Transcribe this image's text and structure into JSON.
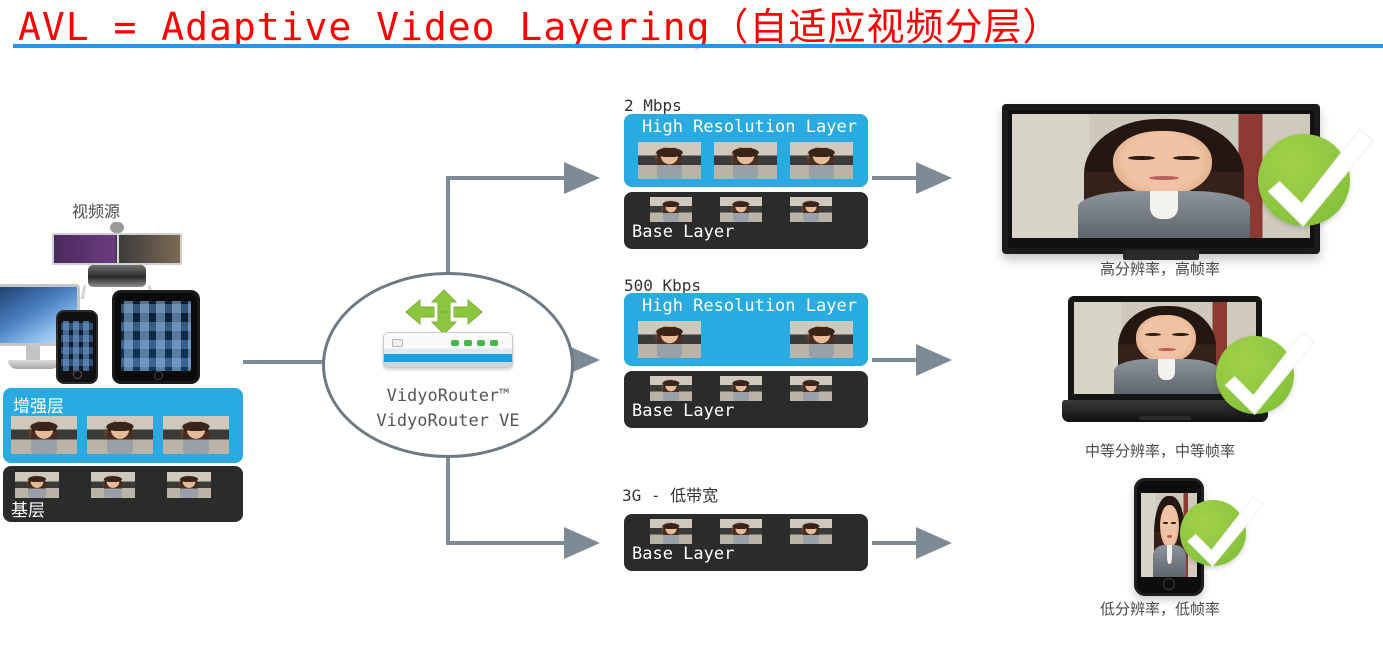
{
  "title": {
    "english": "AVL = Adaptive Video Layering",
    "chinese": "（自适应视频分层）",
    "color": "#FF0000",
    "rule_color": "#2196F3"
  },
  "source": {
    "label": "视频源",
    "devices": [
      {
        "name": "telepresence-system"
      },
      {
        "name": "imac-desktop"
      },
      {
        "name": "iphone"
      },
      {
        "name": "ipad"
      }
    ],
    "stack": {
      "enhancement_layer_label": "增强层",
      "base_layer_label": "基层",
      "enhancement_thumbs": 3,
      "base_thumbs": 3
    }
  },
  "router": {
    "line1": "VidyoRouter™",
    "line2": "VidyoRouter VE"
  },
  "streams": [
    {
      "bitrate": "2 Mbps",
      "high_layer_label": "High Resolution Layer",
      "base_layer_label": "Base Layer",
      "high_thumbs": [
        true,
        true,
        true
      ],
      "base_thumbs": [
        true,
        true,
        true
      ]
    },
    {
      "bitrate": "500 Kbps",
      "high_layer_label": "High Resolution Layer",
      "base_layer_label": "Base Layer",
      "high_thumbs": [
        true,
        false,
        true
      ],
      "base_thumbs": [
        true,
        true,
        true
      ]
    },
    {
      "bitrate": "3G - 低带宽",
      "high_layer_label": "",
      "base_layer_label": "Base Layer",
      "high_thumbs": [],
      "base_thumbs": [
        true,
        true,
        true
      ]
    }
  ],
  "endpoints": [
    {
      "device": "tv-monitor",
      "caption": "高分辨率，高帧率",
      "status": "check"
    },
    {
      "device": "laptop",
      "caption": "中等分辨率，中等帧率",
      "status": "check"
    },
    {
      "device": "smartphone",
      "caption": "低分辨率，低帧率",
      "status": "check"
    }
  ],
  "colors": {
    "layer_blue": "#29ABE2",
    "layer_dark": "#2B2B2B",
    "connector": "#7E8A95",
    "check_green": "#8CC63F"
  }
}
